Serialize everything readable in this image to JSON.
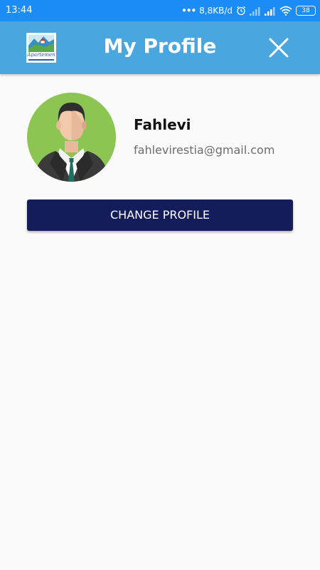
{
  "status_bar": {
    "time": "13:44",
    "dots": "•••",
    "network_speed": "8,8KB/d",
    "battery": "38",
    "icons": [
      "alarm-icon",
      "signal-icon",
      "signal-icon",
      "wifi-icon",
      "battery-icon"
    ]
  },
  "app_bar": {
    "title": "My Profile",
    "logo_text": "Apartemen",
    "close_icon": "close-icon"
  },
  "profile": {
    "name": "Fahlevi",
    "email": "fahlevirestia@gmail.com",
    "avatar_icon": "user-avatar-icon"
  },
  "actions": {
    "change_profile_label": "CHANGE PROFILE"
  },
  "colors": {
    "status_bar": "#1c8df7",
    "app_bar": "#4aa6df",
    "button": "#141c5a",
    "avatar_bg": "#8cc552",
    "background": "#fafafa"
  }
}
